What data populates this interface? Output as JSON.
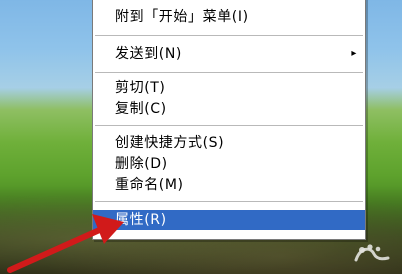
{
  "context_menu": {
    "items": [
      {
        "label": "附到「开始」菜单(I)",
        "selected": false
      },
      {
        "label": "发送到(N)",
        "has_submenu": true,
        "submenu_arrow": "▸",
        "selected": false
      },
      {
        "label": "剪切(T)",
        "selected": false
      },
      {
        "label": "复制(C)",
        "selected": false
      },
      {
        "label": "创建快捷方式(S)",
        "selected": false
      },
      {
        "label": "删除(D)",
        "selected": false
      },
      {
        "label": "重命名(M)",
        "selected": false
      },
      {
        "label": "属性(R)",
        "selected": true
      }
    ]
  },
  "icons": {
    "pointer_arrow": "red-arrow-icon",
    "watermark": "watermark-logo"
  },
  "colors": {
    "selected_background": "#316ac5",
    "selected_text": "#ffffff",
    "menu_background": "#ffffff",
    "separator": "#b9b9b9",
    "arrow": "#d11a1a"
  }
}
